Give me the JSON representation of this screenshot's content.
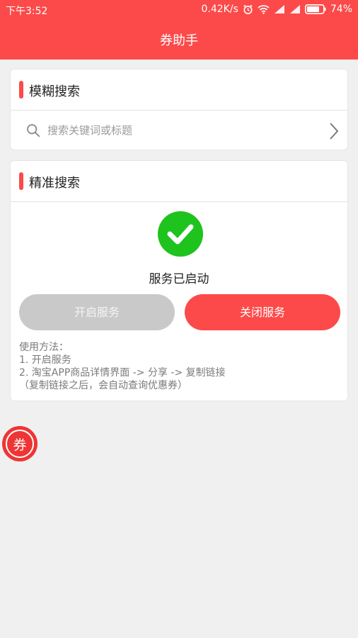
{
  "status_bar": {
    "time": "下午3:52",
    "net_speed": "0.42K/s",
    "battery": "74%"
  },
  "app_bar": {
    "title": "券助手"
  },
  "fuzzy_search": {
    "title": "模糊搜索",
    "placeholder": "搜索关键词或标题"
  },
  "exact_search": {
    "title": "精准搜索",
    "status": "服务已启动",
    "start_button": "开启服务",
    "stop_button": "关闭服务",
    "usage_lines": [
      "使用方法：",
      "1. 开启服务",
      "2. 淘宝APP商品详情界面 -> 分享 -> 复制链接",
      "（复制链接之后，会自动查询优惠券）"
    ]
  },
  "fab": {
    "label": "券"
  },
  "colors": {
    "brand_red": "#fc4a4a",
    "success_green": "#1ec31e",
    "disabled_gray": "#c9c9c9"
  }
}
